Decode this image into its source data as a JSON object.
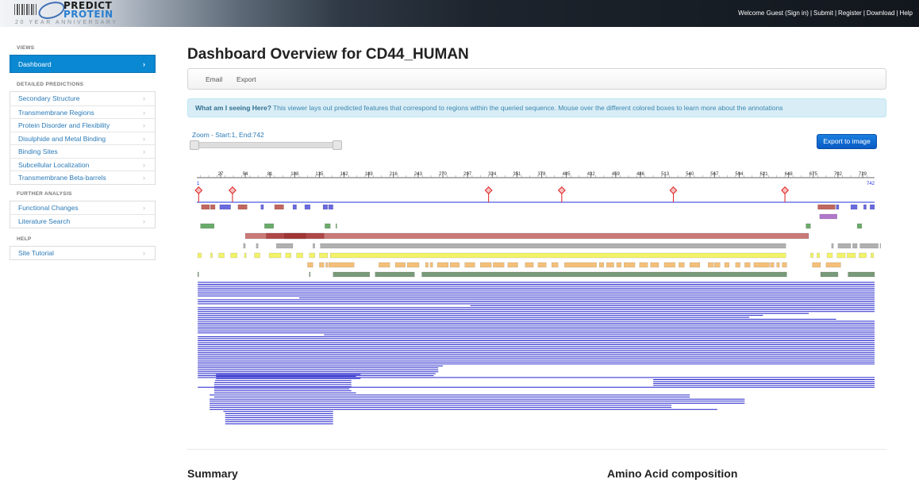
{
  "header": {
    "logo_line1": "PREDICT",
    "logo_line2": "PROTEIN",
    "logo_tagline": "20 YEAR ANNIVERSARY",
    "links": [
      "Welcome Guest (Sign in)",
      "Submit",
      "Register",
      "Download",
      "Help"
    ],
    "separator": "|"
  },
  "sidebar": {
    "views_header": "VIEWS",
    "views": [
      {
        "label": "Dashboard",
        "active": true
      }
    ],
    "detailed_header": "DETAILED PREDICTIONS",
    "detailed": [
      {
        "label": "Secondary Structure"
      },
      {
        "label": "Transmembrane Regions"
      },
      {
        "label": "Protein Disorder and Flexibility"
      },
      {
        "label": "Disulphide and Metal Binding"
      },
      {
        "label": "Binding Sites"
      },
      {
        "label": "Subcellular Localization"
      },
      {
        "label": "Transmembrane Beta-barrels"
      }
    ],
    "further_header": "FURTHER ANALYSIS",
    "further": [
      {
        "label": "Functional Changes"
      },
      {
        "label": "Literature Search"
      }
    ],
    "help_header": "HELP",
    "help": [
      {
        "label": "Site Tutorial"
      }
    ]
  },
  "main": {
    "title": "Dashboard Overview for CD44_HUMAN",
    "toolbar": {
      "email": "Email",
      "export": "Export"
    },
    "info_bold": "What am I seeing Here?",
    "info_text": "This viewer lays out predicted features that correspond to regions within the queried sequence. Mouse over the different colored boxes to learn more about the annotations",
    "zoom_label": "Zoom - Start:1, End:742",
    "zoom": {
      "start": 1,
      "end": 742
    },
    "export_button": "Export to image",
    "summary_title": "Summary",
    "aa_title": "Amino Acid composition"
  },
  "viewer": {
    "seq_start": 1,
    "seq_end": 742,
    "start_label": "1",
    "end_label": "742",
    "ticks": [
      27,
      54,
      81,
      108,
      135,
      162,
      189,
      216,
      243,
      270,
      297,
      324,
      351,
      378,
      405,
      432,
      459,
      486,
      513,
      540,
      567,
      594,
      621,
      648,
      675,
      702,
      729
    ],
    "markers": [
      3,
      40,
      320,
      400,
      522,
      644
    ],
    "colors": {
      "axis": "#2233dd",
      "marker": "#dd2222",
      "red": "#c0675f",
      "blue": "#6a6adf",
      "purple": "#b077c9",
      "green": "#6bab6b",
      "disorder": "#c97a78",
      "disorder_dark": "#a03535",
      "gray": "#b0b0b0",
      "yellow": "#f3f36a",
      "orange": "#f4c07a",
      "darkgreen": "#7a9a7a",
      "alignment": "#2222cc"
    }
  }
}
